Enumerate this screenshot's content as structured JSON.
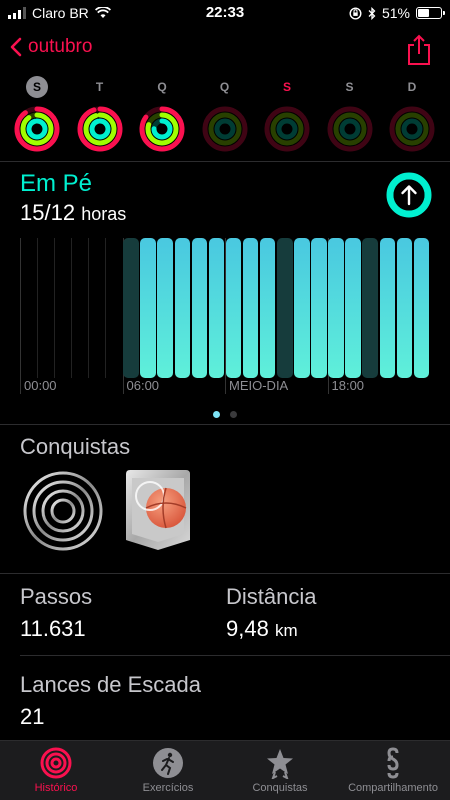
{
  "status_bar": {
    "carrier": "Claro BR",
    "time": "22:33",
    "battery_label": "51%",
    "battery_level": 0.51
  },
  "nav": {
    "back_label": "outubro"
  },
  "week": {
    "days": [
      {
        "label": "S",
        "state": "selected",
        "rings": [
          0.9,
          0.9,
          0.95
        ]
      },
      {
        "label": "T",
        "state": "normal",
        "rings": [
          0.95,
          0.95,
          0.95
        ]
      },
      {
        "label": "Q",
        "state": "normal",
        "rings": [
          0.85,
          0.8,
          0.75
        ]
      },
      {
        "label": "Q",
        "state": "future",
        "rings": [
          0,
          0,
          0
        ]
      },
      {
        "label": "S",
        "state": "today",
        "rings": [
          0,
          0,
          0
        ]
      },
      {
        "label": "S",
        "state": "future",
        "rings": [
          0,
          0,
          0
        ]
      },
      {
        "label": "D",
        "state": "future",
        "rings": [
          0,
          0,
          0
        ]
      }
    ]
  },
  "stand": {
    "title": "Em Pé",
    "value": "15/12",
    "unit": "horas"
  },
  "chart_data": {
    "type": "bar",
    "categories": [
      "00",
      "01",
      "02",
      "03",
      "04",
      "05",
      "06",
      "07",
      "08",
      "09",
      "10",
      "11",
      "12",
      "13",
      "14",
      "15",
      "16",
      "17",
      "18",
      "19",
      "20",
      "21",
      "22",
      "23"
    ],
    "values": [
      0,
      0,
      0,
      0,
      0,
      0,
      0.05,
      1,
      1,
      1,
      1,
      1,
      1,
      1,
      1,
      0.05,
      1,
      1,
      1,
      1,
      0.05,
      1,
      1,
      1
    ],
    "tick_labels": [
      "00:00",
      "06:00",
      "MEIO-DIA",
      "18:00"
    ],
    "colors": {
      "stood": "#5ae8e0",
      "not_stood": "#163c3c"
    }
  },
  "achievements": {
    "title": "Conquistas",
    "items": [
      {
        "icon": "rings-award-icon"
      },
      {
        "icon": "basketball-award-icon"
      }
    ]
  },
  "metrics": {
    "steps_label": "Passos",
    "steps_value": "11.631",
    "distance_label": "Distância",
    "distance_value": "9,48",
    "distance_unit": "km",
    "stairs_label": "Lances de Escada",
    "stairs_value": "21"
  },
  "tabs": [
    {
      "label": "Histórico",
      "icon": "history-rings-icon",
      "active": true
    },
    {
      "label": "Exercícios",
      "icon": "runner-icon",
      "active": false
    },
    {
      "label": "Conquistas",
      "icon": "star-award-icon",
      "active": false
    },
    {
      "label": "Compartilhamento",
      "icon": "sharing-icon",
      "active": false
    }
  ],
  "colors": {
    "accent": "#fa114f",
    "move": "#fa114f",
    "exercise": "#a0ff00",
    "stand": "#00f0d0"
  }
}
